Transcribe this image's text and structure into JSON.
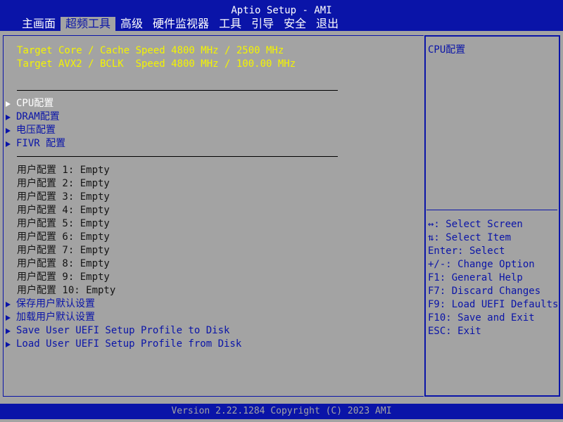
{
  "window": {
    "title": "Aptio Setup - AMI"
  },
  "tabs": [
    {
      "label": "主画面",
      "active": false
    },
    {
      "label": "超频工具",
      "active": true
    },
    {
      "label": "高级",
      "active": false
    },
    {
      "label": "硬件监视器",
      "active": false
    },
    {
      "label": "工具",
      "active": false
    },
    {
      "label": "引导",
      "active": false
    },
    {
      "label": "安全",
      "active": false
    },
    {
      "label": "退出",
      "active": false
    }
  ],
  "info": [
    "Target Core / Cache Speed 4800 MHz / 2500 MHz",
    "Target AVX2 / BCLK  Speed 4800 MHz / 100.00 MHz"
  ],
  "submenus": [
    {
      "label": "CPU配置",
      "selected": true
    },
    {
      "label": "DRAM配置",
      "selected": false
    },
    {
      "label": "电压配置",
      "selected": false
    },
    {
      "label": "FIVR 配置",
      "selected": false
    }
  ],
  "profiles": [
    "用户配置 1: Empty",
    "用户配置 2: Empty",
    "用户配置 3: Empty",
    "用户配置 4: Empty",
    "用户配置 5: Empty",
    "用户配置 6: Empty",
    "用户配置 7: Empty",
    "用户配置 8: Empty",
    "用户配置 9: Empty",
    "用户配置 10: Empty"
  ],
  "actions": [
    "保存用户默认设置",
    "加载用户默认设置",
    "Save User UEFI Setup Profile to Disk",
    "Load User UEFI Setup Profile from Disk"
  ],
  "help": {
    "text": "CPU配置"
  },
  "keys": [
    "↔: Select Screen",
    "⇅: Select Item",
    "Enter: Select",
    "+/-: Change Option",
    "F1: General Help",
    "F7: Discard Changes",
    "F9: Load UEFI Defaults",
    "F10: Save and Exit",
    "ESC: Exit"
  ],
  "footer": {
    "text": "Version 2.22.1284 Copyright (C) 2023 AMI"
  },
  "colors": {
    "accent": "#0a14a8",
    "background": "#a3a3a3",
    "highlight": "#f4f400",
    "selected": "#ffffff"
  }
}
